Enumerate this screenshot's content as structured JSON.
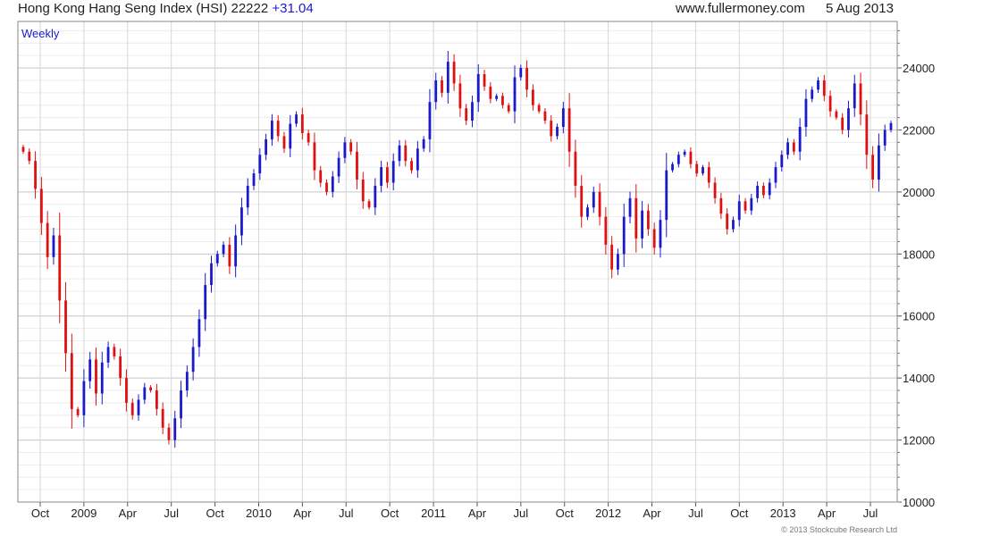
{
  "header": {
    "title": "Hong Kong Hang Seng Index (HSI)",
    "last": "22222",
    "change": "+31.04",
    "website": "www.fullermoney.com",
    "date": "5 Aug 2013"
  },
  "chart_data": {
    "type": "candlestick",
    "period_label": "Weekly",
    "copyright": "© 2013 Stockcube Research Ltd",
    "ylim": [
      10000,
      25500
    ],
    "y_ticks": [
      10000,
      12000,
      14000,
      16000,
      18000,
      20000,
      22000,
      24000
    ],
    "grid": true,
    "x_labels": [
      "Oct",
      "2009",
      "Apr",
      "Jul",
      "Oct",
      "2010",
      "Apr",
      "Jul",
      "Oct",
      "2011",
      "Apr",
      "Jul",
      "Oct",
      "2012",
      "Apr",
      "Jul",
      "Oct",
      "2013",
      "Apr",
      "Jul"
    ],
    "up_color": "#1a1acc",
    "down_color": "#e01010",
    "closes": [
      21300,
      21000,
      20100,
      19000,
      17900,
      18600,
      16500,
      14800,
      13000,
      12800,
      13900,
      14600,
      13500,
      14500,
      15000,
      14700,
      14000,
      13200,
      12800,
      13300,
      13700,
      13600,
      13000,
      12400,
      12000,
      12700,
      13600,
      14200,
      15000,
      15900,
      17000,
      17700,
      18000,
      18300,
      17600,
      18600,
      19500,
      20200,
      20600,
      21200,
      21700,
      22300,
      21800,
      21400,
      22200,
      22500,
      21900,
      21600,
      20700,
      20300,
      20000,
      20500,
      21100,
      21600,
      21300,
      20400,
      19700,
      19500,
      20200,
      20800,
      20300,
      21000,
      21500,
      21000,
      20700,
      21400,
      21700,
      22900,
      23600,
      23200,
      24200,
      23500,
      22700,
      22300,
      22900,
      23800,
      23400,
      23000,
      23100,
      22800,
      22600,
      23700,
      24000,
      23300,
      22800,
      22600,
      22300,
      21800,
      22100,
      22700,
      21300,
      20200,
      19200,
      19500,
      20000,
      19200,
      18300,
      17500,
      18000,
      19200,
      19800,
      18500,
      19400,
      18800,
      18200,
      19100,
      20700,
      20900,
      21200,
      21300,
      20900,
      20600,
      20800,
      20300,
      19800,
      19300,
      18800,
      19100,
      19700,
      19400,
      19800,
      20200,
      19900,
      20300,
      20800,
      21200,
      21600,
      21300,
      22100,
      23000,
      23300,
      23600,
      23100,
      22600,
      22400,
      22000,
      22700,
      23500,
      22500,
      21200,
      20400,
      21500,
      22000,
      22222
    ]
  }
}
